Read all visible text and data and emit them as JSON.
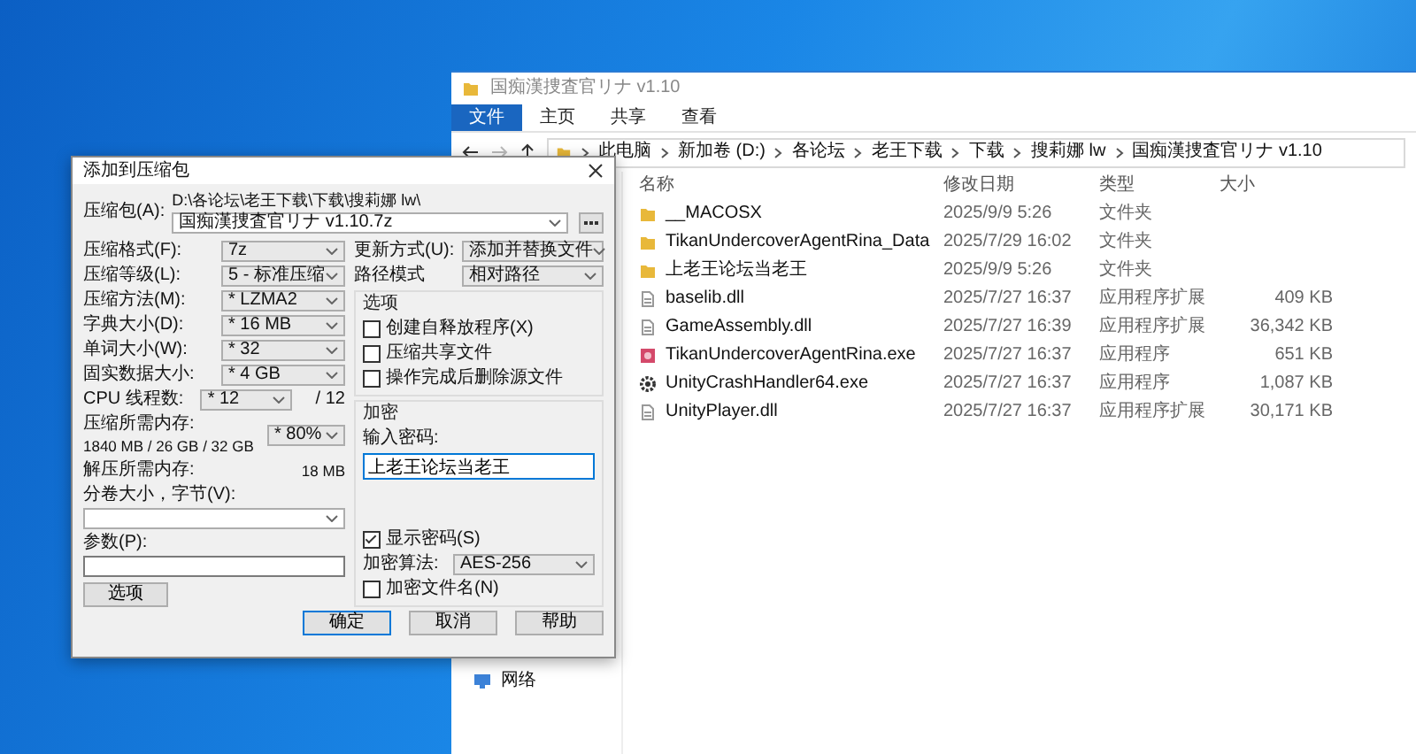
{
  "explorer": {
    "title": "国痴漢捜査官リナ v1.10",
    "ribbon_tabs": [
      {
        "label": "文件",
        "selected": true
      },
      {
        "label": "主页",
        "selected": false
      },
      {
        "label": "共享",
        "selected": false
      },
      {
        "label": "查看",
        "selected": false
      }
    ],
    "breadcrumb": [
      "此电脑",
      "新加卷 (D:)",
      "各论坛",
      "老王下载",
      "下载",
      "搜莉娜 lw",
      "国痴漢捜査官リナ v1.10"
    ],
    "columns": [
      "名称",
      "修改日期",
      "类型",
      "大小"
    ],
    "files": [
      {
        "kind": "folder",
        "name": "__MACOSX",
        "modified": "2025/9/9 5:26",
        "type": "文件夹"
      },
      {
        "kind": "folder",
        "name": "TikanUndercoverAgentRina_Data",
        "modified": "2025/7/29 16:02",
        "type": "文件夹"
      },
      {
        "kind": "folder",
        "name": "上老王论坛当老王",
        "modified": "2025/9/9 5:26",
        "type": "文件夹"
      },
      {
        "kind": "dll",
        "name": "baselib.dll",
        "modified": "2025/7/27 16:37",
        "type": "应用程序扩展",
        "size": "409 KB"
      },
      {
        "kind": "dll",
        "name": "GameAssembly.dll",
        "modified": "2025/7/27 16:39",
        "type": "应用程序扩展",
        "size": "36,342 KB"
      },
      {
        "kind": "app",
        "name": "TikanUndercoverAgentRina.exe",
        "modified": "2025/7/27 16:37",
        "type": "应用程序",
        "size": "651 KB"
      },
      {
        "kind": "gear",
        "name": "UnityCrashHandler64.exe",
        "modified": "2025/7/27 16:37",
        "type": "应用程序",
        "size": "1,087 KB"
      },
      {
        "kind": "dll",
        "name": "UnityPlayer.dll",
        "modified": "2025/7/27 16:37",
        "type": "应用程序扩展",
        "size": "30,171 KB"
      }
    ],
    "nav_items": [
      "网络"
    ]
  },
  "dialog": {
    "title": "添加到压缩包",
    "archive_label": "压缩包(A):",
    "archive_path": "D:\\各论坛\\老王下载\\下载\\搜莉娜 lw\\",
    "archive_name": "国痴漢捜査官リナ v1.10.7z",
    "left": [
      {
        "kind": "combo",
        "label": "压缩格式(F):",
        "value": "7z"
      },
      {
        "kind": "combo",
        "label": "压缩等级(L):",
        "value": "5 - 标准压缩"
      },
      {
        "kind": "combo",
        "label": "压缩方法(M):",
        "value": "* LZMA2"
      },
      {
        "kind": "combo",
        "label": "字典大小(D):",
        "value": "* 16 MB"
      },
      {
        "kind": "combo",
        "label": "单词大小(W):",
        "value": "* 32"
      },
      {
        "kind": "combo",
        "label": "固实数据大小:",
        "value": "* 4 GB"
      },
      {
        "kind": "combo",
        "label": "CPU 线程数:",
        "value": "* 12",
        "suffix": "/ 12"
      },
      {
        "kind": "memory",
        "label": "压缩所需内存:",
        "detail": "1840 MB / 26 GB / 32 GB",
        "value": "* 80%"
      },
      {
        "kind": "reading",
        "label": "解压所需内存:",
        "value": "18 MB"
      },
      {
        "kind": "wide_combo",
        "label": "分卷大小，字节(V):"
      },
      {
        "kind": "wide_input",
        "label": "参数(P):"
      }
    ],
    "options_button": "选项",
    "update": {
      "label": "更新方式(U):",
      "value": "添加并替换文件"
    },
    "path_mode": {
      "label": "路径模式",
      "value": "相对路径"
    },
    "options_group": {
      "title": "选项",
      "items": [
        {
          "label": "创建自释放程序(X)",
          "checked": false
        },
        {
          "label": "压缩共享文件",
          "checked": false
        },
        {
          "label": "操作完成后删除源文件",
          "checked": false
        }
      ]
    },
    "encryption": {
      "title": "加密",
      "password_label": "输入密码:",
      "password": "上老王论坛当老王",
      "show_password": {
        "label": "显示密码(S)",
        "checked": true
      },
      "method": {
        "label": "加密算法:",
        "value": "AES-256"
      },
      "encrypt_names": {
        "label": "加密文件名(N)",
        "checked": false
      }
    },
    "buttons": [
      {
        "label": "确定",
        "default": true
      },
      {
        "label": "取消",
        "default": false
      },
      {
        "label": "帮助",
        "default": false
      }
    ]
  }
}
